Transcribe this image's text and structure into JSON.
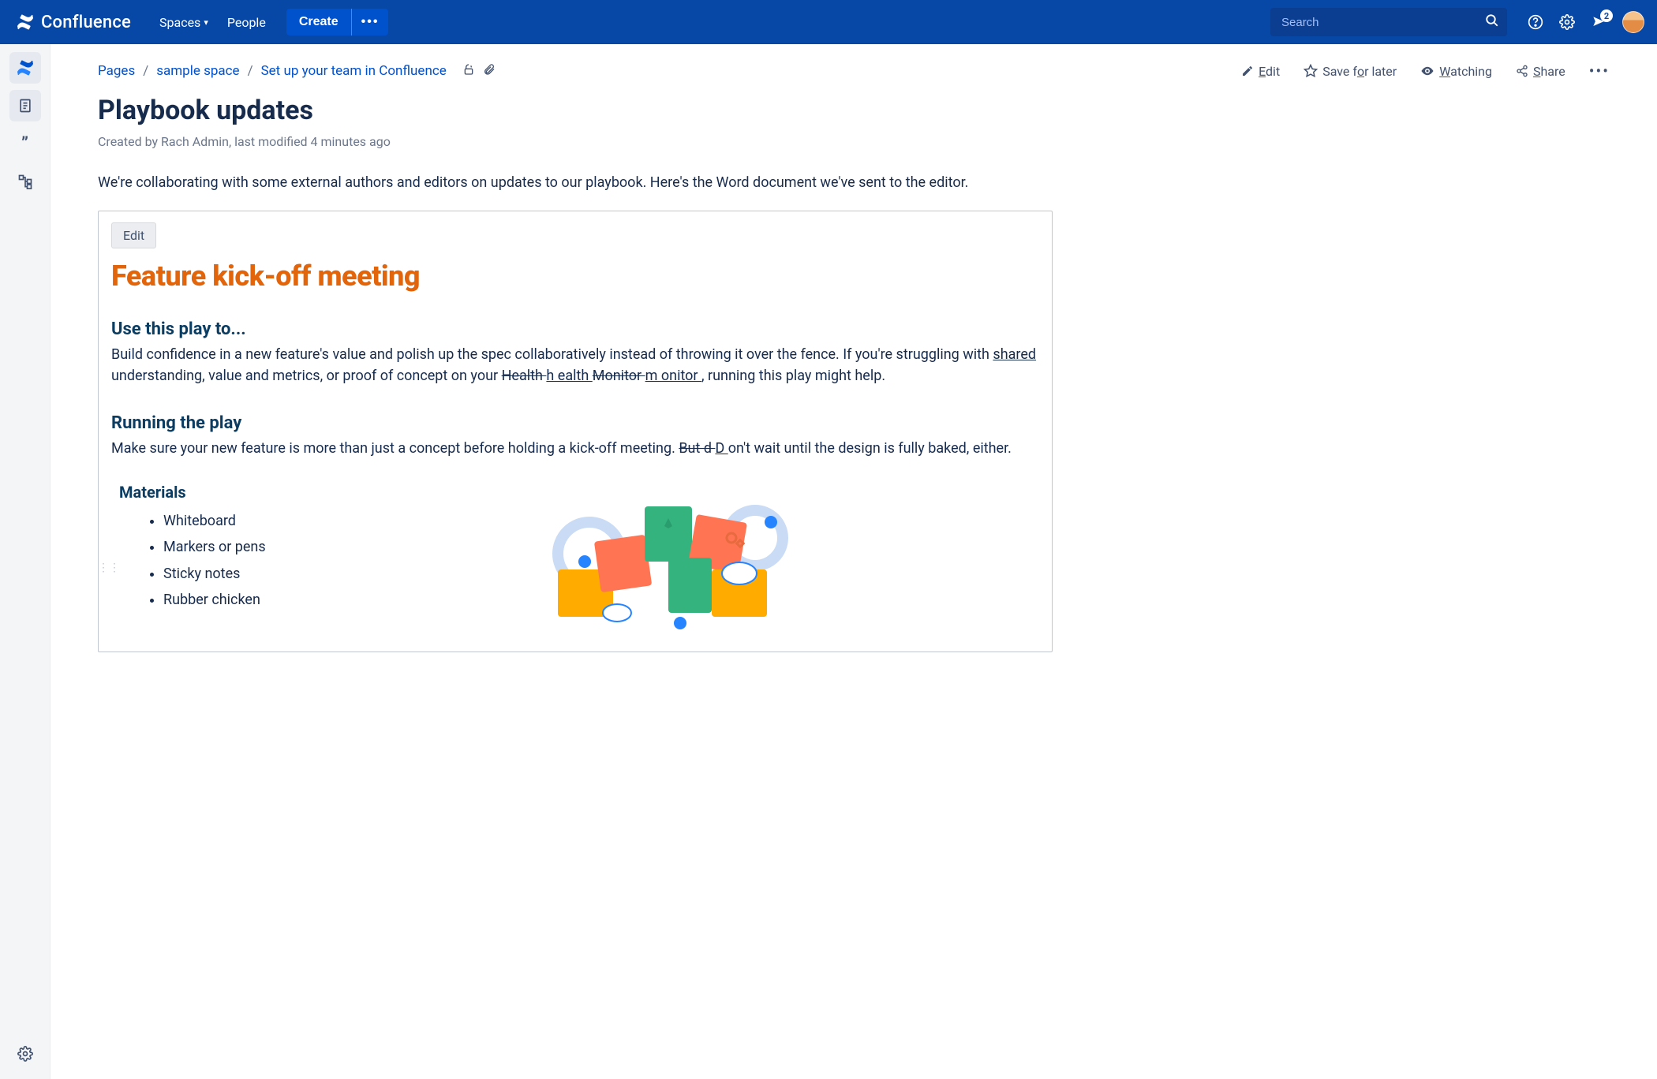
{
  "topbar": {
    "product": "Confluence",
    "spaces": "Spaces",
    "people": "People",
    "create": "Create",
    "create_more": "•••",
    "search_placeholder": "Search",
    "notif_count": "2"
  },
  "breadcrumbs": {
    "pages": "Pages",
    "space": "sample space",
    "parent": "Set up your team in Confluence"
  },
  "actions": {
    "edit_prefix": "E",
    "edit_rest": "dit",
    "save": "Save f",
    "save_ul": "o",
    "save_rest": "r later",
    "watching_prefix": "W",
    "watching_rest": "atching",
    "share_prefix": "S",
    "share_rest": "hare"
  },
  "page": {
    "title": "Playbook updates",
    "byline": "Created by Rach Admin, last modified 4 minutes ago",
    "intro": "We're collaborating with some external authors and editors on updates to our playbook.  Here's the Word document we've sent to the editor."
  },
  "embed": {
    "edit": "Edit",
    "title": "Feature kick-off meeting",
    "use_h": "Use this play to...",
    "use_p1": "Build confidence in a new feature's value and polish up the spec collaboratively instead of throwing it over the fence. If you're struggling with ",
    "use_ins1": "shared ",
    "use_mid1": "understanding, value and metrics, or proof of concept on your ",
    "use_del1": "Health ",
    "use_ins2": "h ealth ",
    "use_del2": "Monitor ",
    "use_ins3": "m onitor ",
    "use_end": ", running this play might help.",
    "run_h": "Running the play",
    "run_p1": "Make sure your new feature is more than just a concept before holding a kick-off meeting. ",
    "run_del": "But d ",
    "run_ins": "D ",
    "run_end": "on't wait until the design is fully baked, either.",
    "mat_h": "Materials",
    "materials": [
      "Whiteboard",
      "Markers or pens",
      "Sticky notes",
      "Rubber chicken"
    ]
  }
}
